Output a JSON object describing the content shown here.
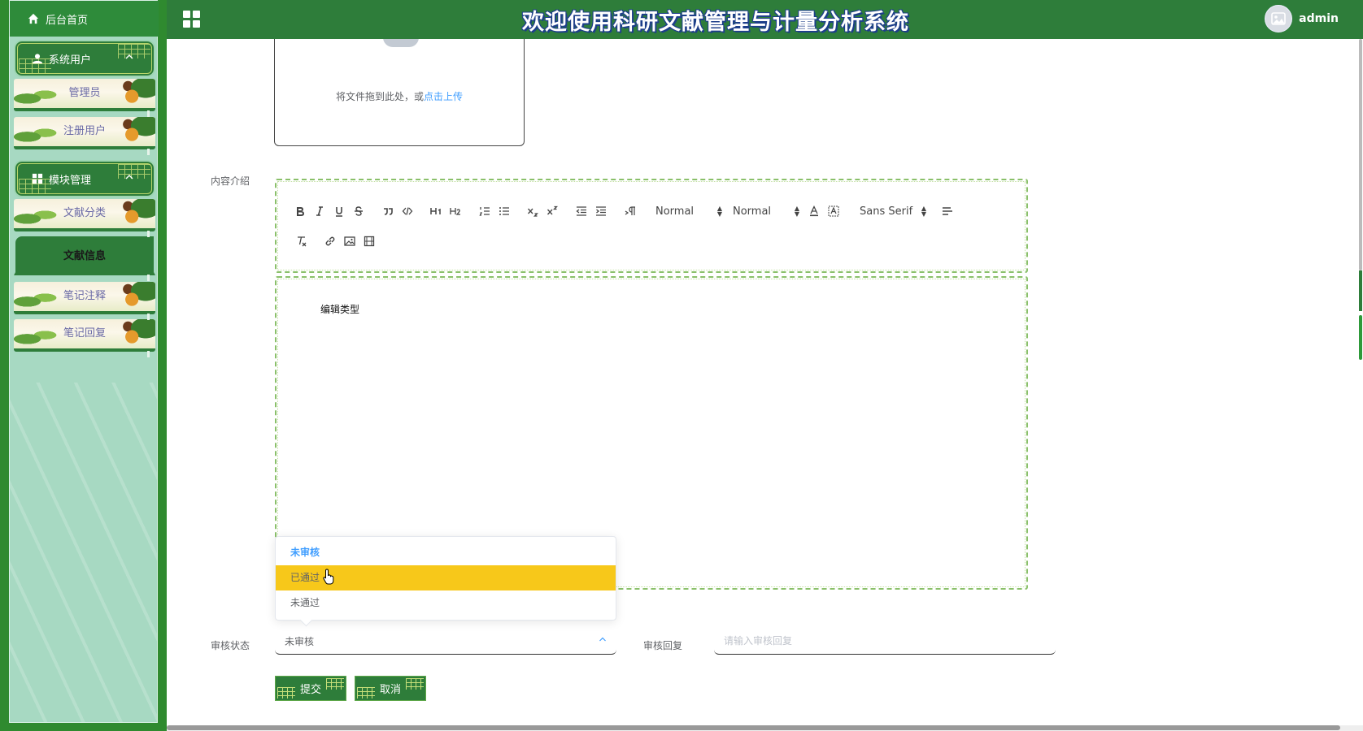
{
  "header": {
    "title": "欢迎使用科研文献管理与计量分析系统",
    "user_name": "admin"
  },
  "sidebar": {
    "home_label": "后台首页",
    "groups": [
      {
        "label": "系统用户",
        "items": [
          "管理员",
          "注册用户"
        ]
      },
      {
        "label": "模块管理",
        "items": [
          "文献分类",
          "文献信息",
          "笔记注释",
          "笔记回复"
        ]
      }
    ],
    "active_item": "文献信息"
  },
  "upload": {
    "hint": "将文件拖到此处，或",
    "link": "点击上传"
  },
  "editor": {
    "label": "内容介绍",
    "toolbar": {
      "header_select": "Normal",
      "size_select": "Normal",
      "font_select": "Sans Serif"
    },
    "content": "编辑类型"
  },
  "review_status": {
    "label": "审核状态",
    "value": "未审核",
    "options": [
      "未审核",
      "已通过",
      "未通过"
    ],
    "hovered_option": "已通过"
  },
  "review_reply": {
    "label": "审核回复",
    "placeholder": "请输入审核回复"
  },
  "buttons": {
    "submit": "提交",
    "cancel": "取消"
  },
  "colors": {
    "primary_green": "#2e7d3a",
    "sidebar_bg": "#a7d9c2",
    "hover_yellow": "#f7c81a",
    "link_blue": "#409eff"
  }
}
